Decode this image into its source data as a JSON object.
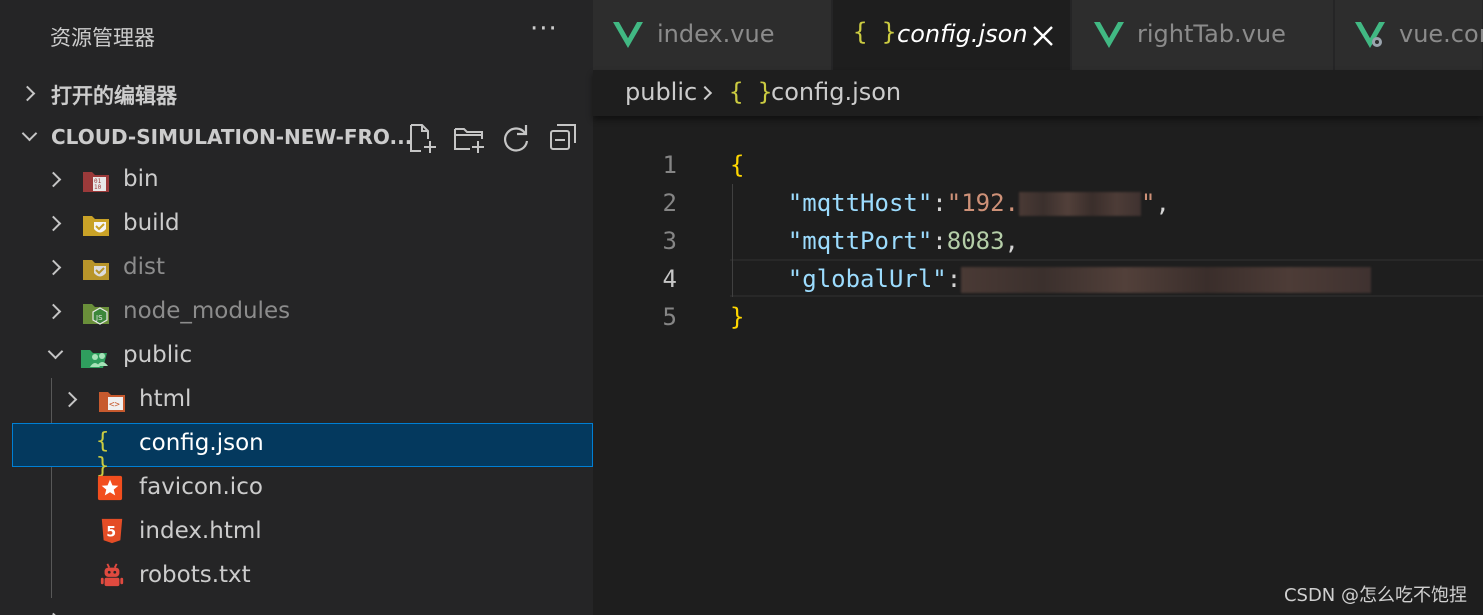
{
  "sidebar": {
    "title": "资源管理器",
    "more_label": "···",
    "open_editors_label": "打开的编辑器",
    "project_label": "CLOUD-SIMULATION-NEW-FRO...",
    "tree": [
      {
        "label": "bin",
        "icon": "folder-bin-icon",
        "expanded": false
      },
      {
        "label": "build",
        "icon": "folder-build-icon",
        "expanded": false
      },
      {
        "label": "dist",
        "icon": "folder-dist-icon",
        "expanded": false
      },
      {
        "label": "node_modules",
        "icon": "folder-node-icon",
        "expanded": false
      },
      {
        "label": "public",
        "icon": "folder-public-icon",
        "expanded": true
      },
      {
        "label": "html",
        "icon": "folder-html-icon",
        "expanded": false
      },
      {
        "label": "config.json",
        "icon": "json-file-icon"
      },
      {
        "label": "favicon.ico",
        "icon": "favicon-file-icon"
      },
      {
        "label": "index.html",
        "icon": "html5-file-icon"
      },
      {
        "label": "robots.txt",
        "icon": "robots-file-icon"
      }
    ]
  },
  "tabs": [
    {
      "label": "index.vue",
      "icon": "vue-icon",
      "active": false
    },
    {
      "label": "config.json",
      "icon": "json-braces-icon",
      "active": true
    },
    {
      "label": "rightTab.vue",
      "icon": "vue-icon",
      "active": false
    },
    {
      "label": "vue.con",
      "icon": "vue-config-icon",
      "active": false
    }
  ],
  "breadcrumb": {
    "folder": "public",
    "file": "config.json",
    "braces": "{ }"
  },
  "editor": {
    "line_numbers": [
      "1",
      "2",
      "3",
      "4",
      "5"
    ],
    "current_line": 4,
    "open_brace": "{",
    "close_brace": "}",
    "line2_key": "\"mqttHost\"",
    "line2_value_visible": "\"192.",
    "line3_key": "\"mqttPort\"",
    "line3_value": "8083",
    "line4_key": "\"globalUrl\"",
    "colon": ":",
    "comma": ","
  },
  "watermark": "CSDN @怎么吃不饱捏",
  "colors": {
    "vue_green": "#41b883",
    "json_yellow": "#cbcb41",
    "selection": "#04395e",
    "focus_border": "#007fd4"
  }
}
